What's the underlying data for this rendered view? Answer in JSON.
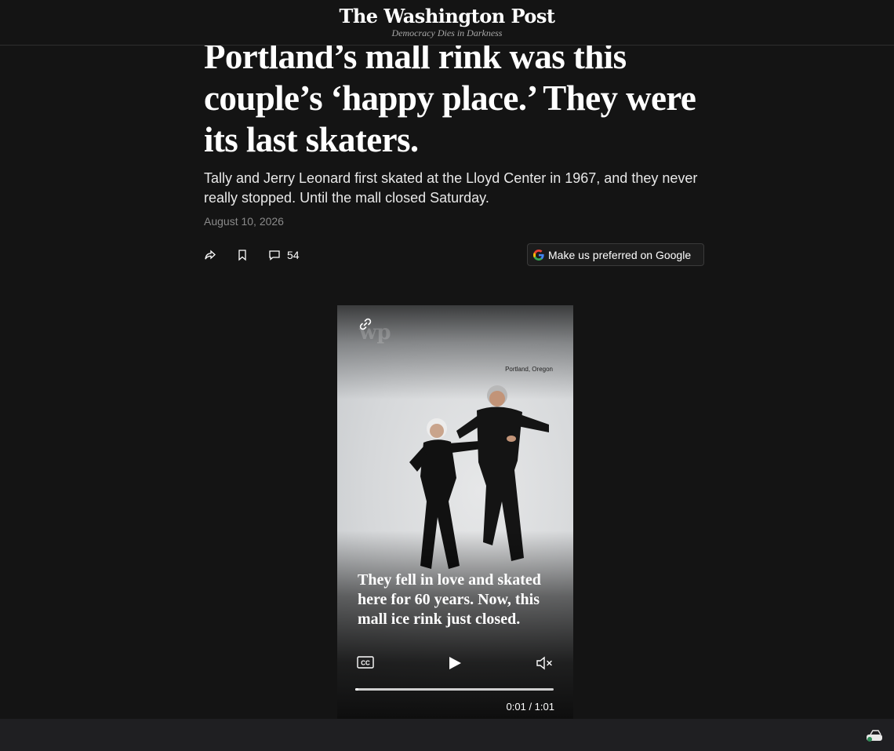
{
  "masthead": {
    "logo": "The Washington Post",
    "tagline": "Democracy Dies in Darkness"
  },
  "article": {
    "headline": "Portland’s mall rink was this couple’s ‘happy place.’ They were its last skaters.",
    "dek": "Tally and Jerry Leonard first skated at the Lloyd Center in 1967, and they never really stopped. Until the mall closed Saturday.",
    "date": "August 10, 2026",
    "comment_count": "54",
    "google_button": "Make us preferred on Google"
  },
  "video": {
    "location": "Portland, Oregon",
    "caption": "They fell in love and skated here for 60 years. Now, this mall ice rink just closed.",
    "time": "0:01 / 1:01",
    "progress": 0.016,
    "icons": [
      "link-icon",
      "closed-captions-icon",
      "play-icon",
      "muted-speaker-icon"
    ]
  },
  "colors": {
    "background": "#141414",
    "text": "#ffffff",
    "muted": "#8a8a8a"
  }
}
